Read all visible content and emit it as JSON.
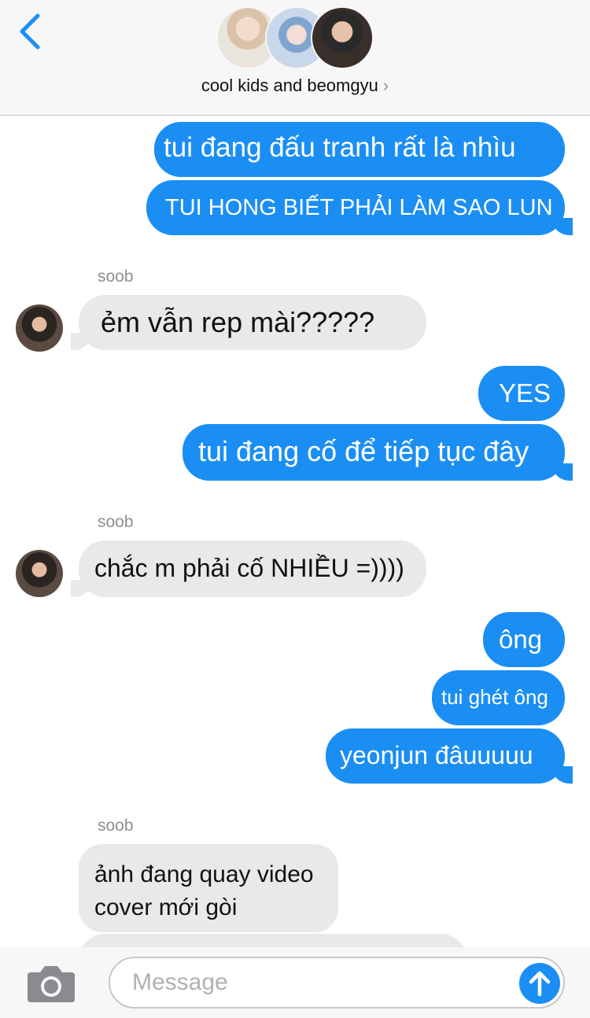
{
  "header": {
    "back_icon": "chevron-left-icon",
    "group_name": "cool kids and beomgyu",
    "chevron": "›",
    "accent": "#1b8ef3"
  },
  "messages": [
    {
      "dir": "out",
      "text": "tui đang đấu tranh rất là nhìu"
    },
    {
      "dir": "out",
      "text": "TUI HONG BIẾT PHẢI LÀM SAO LUN"
    },
    {
      "dir": "in",
      "sender": "soob",
      "text": "ẻm vẫn rep mài?????"
    },
    {
      "dir": "out",
      "text": "YES"
    },
    {
      "dir": "out",
      "text": "tui đang cố để tiếp tục đây"
    },
    {
      "dir": "in",
      "sender": "soob",
      "text": "chắc m phải cố NHIỀU =))))"
    },
    {
      "dir": "out",
      "text": "ông"
    },
    {
      "dir": "out",
      "text": "tui ghét ông"
    },
    {
      "dir": "out",
      "text": "yeonjun đâuuuuu"
    },
    {
      "dir": "in",
      "sender": "soob",
      "text_line1": "ảnh đang quay video",
      "text_line2": "cover mới gòi"
    }
  ],
  "footer": {
    "camera_icon": "camera-icon",
    "placeholder": "Message",
    "send_icon": "arrow-up-icon"
  }
}
